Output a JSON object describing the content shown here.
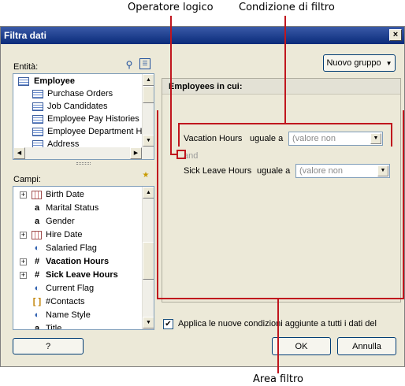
{
  "callouts": {
    "operator": "Operatore logico",
    "condition": "Condizione di filtro",
    "area": "Area filtro"
  },
  "dialog": {
    "title": "Filtra dati",
    "close_label": "×"
  },
  "entities": {
    "label": "Entità:",
    "items": [
      {
        "label": "Employee",
        "selected": true
      },
      {
        "label": "Purchase Orders"
      },
      {
        "label": "Job Candidates"
      },
      {
        "label": "Employee Pay Histories"
      },
      {
        "label": "Employee Department His"
      },
      {
        "label": "Address"
      }
    ]
  },
  "fields": {
    "label": "Campi:",
    "items": [
      {
        "label": "Birth Date",
        "expand": "+",
        "icon": "grid"
      },
      {
        "label": "Marital Status",
        "icon": "a"
      },
      {
        "label": "Gender",
        "icon": "a"
      },
      {
        "label": "Hire Date",
        "expand": "+",
        "icon": "grid"
      },
      {
        "label": "Salaried Flag",
        "icon": "flag"
      },
      {
        "label": "Vacation Hours",
        "expand": "+",
        "icon": "#",
        "bold": true
      },
      {
        "label": "Sick Leave Hours",
        "expand": "+",
        "icon": "#",
        "bold": true
      },
      {
        "label": "Current Flag",
        "icon": "flag"
      },
      {
        "label": "#Contacts",
        "icon": "bracket"
      },
      {
        "label": "Name Style",
        "icon": "flag"
      },
      {
        "label": "Title",
        "icon": "a"
      }
    ]
  },
  "new_group_button": "Nuovo gruppo",
  "filter": {
    "header": "Employees in cui:",
    "conditions": [
      {
        "field": "Vacation Hours",
        "operator": "uguale a",
        "value_placeholder": "(valore non"
      },
      {
        "field": "Sick Leave Hours",
        "operator": "uguale a",
        "value_placeholder": "(valore non"
      }
    ],
    "logical_operator": "and"
  },
  "apply_checkbox": {
    "checked": true,
    "label": "Applica le nuove condizioni aggiunte a tutti i dati del"
  },
  "buttons": {
    "help": "?",
    "ok": "OK",
    "cancel": "Annulla"
  }
}
